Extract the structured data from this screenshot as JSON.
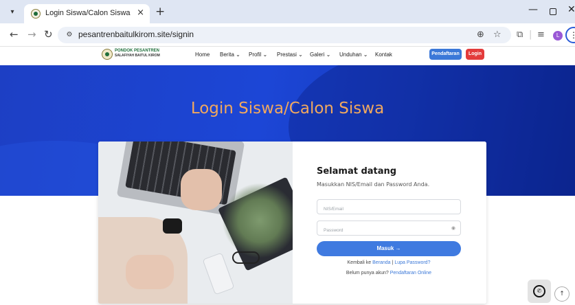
{
  "browser": {
    "tab_title": "Login Siswa/Calon Siswa",
    "tab_close": "×",
    "new_tab": "+",
    "url": "pesantrenbaitulkirom.site/signin",
    "profile_initial": "L",
    "icons": {
      "back": "arrow-left-icon",
      "forward": "arrow-right-icon",
      "reload": "reload-icon",
      "site_info": "tune-icon",
      "zoom": "zoom-icon",
      "bookmark": "star-icon",
      "extensions": "puzzle-icon",
      "media": "playlist-icon",
      "menu": "kebab-icon"
    }
  },
  "site": {
    "logo_line1": "PONDOK PESANTREN",
    "logo_line2": "SALAFIYAH BAITUL KIROM",
    "menu": [
      {
        "label": "Home"
      },
      {
        "label": "Berita ⌄"
      },
      {
        "label": "Profil ⌄"
      },
      {
        "label": "Prestasi ⌄"
      },
      {
        "label": "Galeri ⌄"
      },
      {
        "label": "Unduhan ⌄"
      },
      {
        "label": "Kontak"
      }
    ],
    "register_button": "Pendaftaran",
    "login_button": "Login"
  },
  "hero": {
    "title": "Login Siswa/Calon Siswa"
  },
  "form": {
    "welcome": "Selamat datang",
    "subtitle": "Masukkan NIS/Email dan Password Anda.",
    "nis_placeholder": "NIS/Email",
    "password_placeholder": "Password",
    "submit": "Masuk →",
    "back_prefix": "Kembali ke",
    "back_home": "Beranda",
    "separator": "|",
    "forgot": "Lupa Password?",
    "no_account": "Belum punya akun?",
    "register_online": "Pendaftaran Online"
  },
  "colors": {
    "primary": "#3b78d8",
    "hero_bg": "#1c46d6",
    "hero_title": "#f1a85e",
    "login_red": "#e33b3b"
  }
}
